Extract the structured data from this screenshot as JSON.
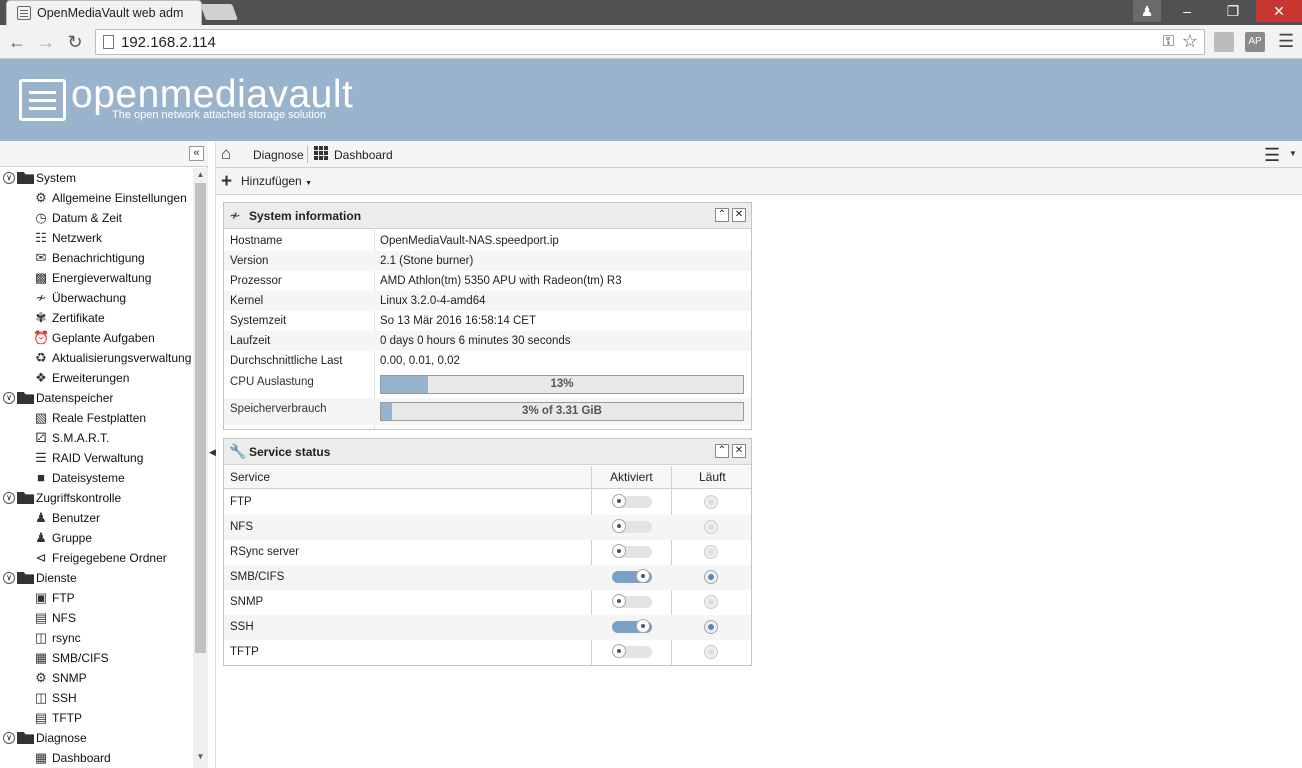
{
  "browser": {
    "tab_title": "OpenMediaVault web adm",
    "url": "192.168.2.114"
  },
  "header": {
    "title": "openmediavault",
    "subtitle": "The open network attached storage solution"
  },
  "sidebar": {
    "groups": [
      {
        "label": "System",
        "items": [
          "Allgemeine Einstellungen",
          "Datum & Zeit",
          "Netzwerk",
          "Benachrichtigung",
          "Energieverwaltung",
          "Überwachung",
          "Zertifikate",
          "Geplante Aufgaben",
          "Aktualisierungsverwaltung",
          "Erweiterungen"
        ]
      },
      {
        "label": "Datenspeicher",
        "items": [
          "Reale Festplatten",
          "S.M.A.R.T.",
          "RAID Verwaltung",
          "Dateisysteme"
        ]
      },
      {
        "label": "Zugriffskontrolle",
        "items": [
          "Benutzer",
          "Gruppe",
          "Freigegebene Ordner"
        ]
      },
      {
        "label": "Dienste",
        "items": [
          "FTP",
          "NFS",
          "rsync",
          "SMB/CIFS",
          "SNMP",
          "SSH",
          "TFTP"
        ]
      },
      {
        "label": "Diagnose",
        "items": [
          "Dashboard"
        ]
      }
    ]
  },
  "breadcrumb": {
    "items": [
      "Diagnose",
      "Dashboard"
    ]
  },
  "toolbar": {
    "add_label": "Hinzufügen"
  },
  "sysinfo": {
    "title": "System information",
    "rows": [
      {
        "key": "Hostname",
        "value": "OpenMediaVault-NAS.speedport.ip"
      },
      {
        "key": "Version",
        "value": "2.1 (Stone burner)"
      },
      {
        "key": "Prozessor",
        "value": "AMD Athlon(tm) 5350 APU with Radeon(tm) R3"
      },
      {
        "key": "Kernel",
        "value": "Linux 3.2.0-4-amd64"
      },
      {
        "key": "Systemzeit",
        "value": "So 13 Mär 2016 16:58:14 CET"
      },
      {
        "key": "Laufzeit",
        "value": "0 days 0 hours 6 minutes 30 seconds"
      },
      {
        "key": "Durchschnittliche Last",
        "value": "0.00, 0.01, 0.02"
      }
    ],
    "cpu": {
      "label": "CPU Auslastung",
      "text": "13%",
      "percent": 13
    },
    "memory": {
      "label": "Speicherverbrauch",
      "text": "3% of 3.31 GiB",
      "percent": 3
    }
  },
  "services": {
    "title": "Service status",
    "columns": [
      "Service",
      "Aktiviert",
      "Läuft"
    ],
    "rows": [
      {
        "name": "FTP",
        "enabled": false,
        "running": false
      },
      {
        "name": "NFS",
        "enabled": false,
        "running": false
      },
      {
        "name": "RSync server",
        "enabled": false,
        "running": false
      },
      {
        "name": "SMB/CIFS",
        "enabled": true,
        "running": true
      },
      {
        "name": "SNMP",
        "enabled": false,
        "running": false
      },
      {
        "name": "SSH",
        "enabled": true,
        "running": true
      },
      {
        "name": "TFTP",
        "enabled": false,
        "running": false
      }
    ]
  },
  "colors": {
    "header_bg": "#9ab3cc",
    "accent": "#7aa0c8",
    "progress_fill": "#97b3ce"
  }
}
